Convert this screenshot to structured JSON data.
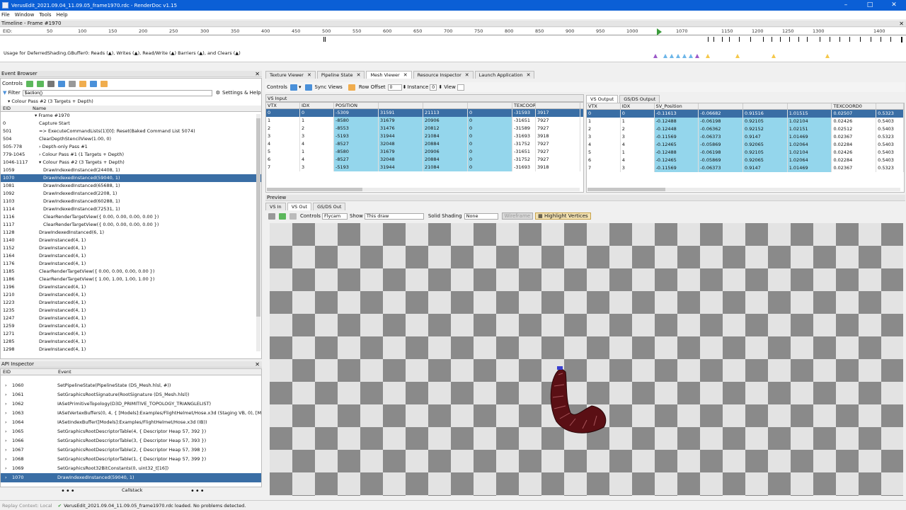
{
  "window": {
    "title": "VerusEdit_2021.09.04_11.09.05_frame1970.rdc - RenderDoc v1.15"
  },
  "menu": [
    "File",
    "Window",
    "Tools",
    "Help"
  ],
  "timeline": {
    "title": "Timeline - Frame #1970",
    "eid_label": "EID:",
    "ticks": [
      "50",
      "100",
      "150",
      "200",
      "250",
      "300",
      "350",
      "400",
      "450",
      "500",
      "550",
      "600",
      "650",
      "700",
      "750",
      "800",
      "850",
      "900",
      "950",
      "1000",
      "1070",
      "1150",
      "1200",
      "1250",
      "1300",
      "1400"
    ],
    "usage_text": "Usage for DeferredShading.GBuffer0: Reads (▲), Writes (▲), Read/Write (▲) Barriers (▲), and Clears (▲)"
  },
  "event_browser": {
    "title": "Event Browser",
    "controls_label": "Controls",
    "filter_label": "Filter",
    "filter_value": "$action()",
    "settings_label": "Settings & Help",
    "breadcrumb": "Colour Pass #2 (3 Targets + Depth)",
    "col_eid": "EID",
    "col_name": "Name",
    "rows": [
      {
        "eid": "",
        "name": "▾ Frame #1970",
        "indent": 1
      },
      {
        "eid": "0",
        "name": "Capture Start",
        "indent": 2
      },
      {
        "eid": "501",
        "name": "=> ExecuteCommandLists(1)[0]: Reset(Baked Command List 5074)",
        "indent": 2
      },
      {
        "eid": "504",
        "name": "ClearDepthStencilView(1.00, 0)",
        "indent": 2
      },
      {
        "eid": "505-778",
        "name": "› Depth-only Pass #1",
        "indent": 2
      },
      {
        "eid": "779-1045",
        "name": "› Colour Pass #1 (1 Targets + Depth)",
        "indent": 2
      },
      {
        "eid": "1046-1117",
        "name": "▾ Colour Pass #2 (3 Targets + Depth)",
        "indent": 2
      },
      {
        "eid": "1059",
        "name": "DrawIndexedInstanced(24408, 1)",
        "indent": 3
      },
      {
        "eid": "1070",
        "name": "DrawIndexedInstanced(59040, 1)",
        "indent": 3,
        "selected": true
      },
      {
        "eid": "1081",
        "name": "DrawIndexedInstanced(65688, 1)",
        "indent": 3
      },
      {
        "eid": "1092",
        "name": "DrawIndexedInstanced(2208, 1)",
        "indent": 3
      },
      {
        "eid": "1103",
        "name": "DrawIndexedInstanced(60288, 1)",
        "indent": 3
      },
      {
        "eid": "1114",
        "name": "DrawIndexedInstanced(72531, 1)",
        "indent": 3
      },
      {
        "eid": "1116",
        "name": "ClearRenderTargetView({ 0.00, 0.00, 0.00, 0.00 })",
        "indent": 3
      },
      {
        "eid": "1117",
        "name": "ClearRenderTargetView({ 0.00, 0.00, 0.00, 0.00 })",
        "indent": 3
      },
      {
        "eid": "1128",
        "name": "DrawIndexedInstanced(6, 1)",
        "indent": 2
      },
      {
        "eid": "1140",
        "name": "DrawInstanced(4, 1)",
        "indent": 2
      },
      {
        "eid": "1152",
        "name": "DrawInstanced(4, 1)",
        "indent": 2
      },
      {
        "eid": "1164",
        "name": "DrawInstanced(4, 1)",
        "indent": 2
      },
      {
        "eid": "1176",
        "name": "DrawInstanced(4, 1)",
        "indent": 2
      },
      {
        "eid": "1185",
        "name": "ClearRenderTargetView({ 0.00, 0.00, 0.00, 0.00 })",
        "indent": 2
      },
      {
        "eid": "1186",
        "name": "ClearRenderTargetView({ 1.00, 1.00, 1.00, 1.00 })",
        "indent": 2
      },
      {
        "eid": "1196",
        "name": "DrawInstanced(4, 1)",
        "indent": 2
      },
      {
        "eid": "1210",
        "name": "DrawInstanced(4, 1)",
        "indent": 2
      },
      {
        "eid": "1223",
        "name": "DrawInstanced(4, 1)",
        "indent": 2
      },
      {
        "eid": "1235",
        "name": "DrawInstanced(4, 1)",
        "indent": 2
      },
      {
        "eid": "1247",
        "name": "DrawInstanced(4, 1)",
        "indent": 2
      },
      {
        "eid": "1259",
        "name": "DrawInstanced(4, 1)",
        "indent": 2
      },
      {
        "eid": "1271",
        "name": "DrawInstanced(4, 1)",
        "indent": 2
      },
      {
        "eid": "1285",
        "name": "DrawInstanced(4, 1)",
        "indent": 2
      },
      {
        "eid": "1298",
        "name": "DrawInstanced(4, 1)",
        "indent": 2
      }
    ]
  },
  "api_inspector": {
    "title": "API Inspector",
    "col_eid": "EID",
    "col_event": "Event",
    "rows": [
      {
        "eid": "1060",
        "event": "SetPipelineState(PipelineState (DS_Mesh.hlsl, #))"
      },
      {
        "eid": "1061",
        "event": "SetGraphicsRootSignature(RootSignature (DS_Mesh.hlsl))"
      },
      {
        "eid": "1062",
        "event": "IASetPrimitiveTopology(D3D_PRIMITIVE_TOPOLOGY_TRIANGLELIST)"
      },
      {
        "eid": "1063",
        "event": "IASetVertexBuffers(0, 4, { [Models]:Examples/FlightHelmet/Hose.x3d (Staging VB, 0), [Mo"
      },
      {
        "eid": "1064",
        "event": "IASetIndexBuffer([Models]:Examples/FlightHelmet/Hose.x3d (IB))"
      },
      {
        "eid": "1065",
        "event": "SetGraphicsRootDescriptorTable(4, { Descriptor Heap 57, 392 })"
      },
      {
        "eid": "1066",
        "event": "SetGraphicsRootDescriptorTable(3, { Descriptor Heap 57, 393 })"
      },
      {
        "eid": "1067",
        "event": "SetGraphicsRootDescriptorTable(2, { Descriptor Heap 57, 398 })"
      },
      {
        "eid": "1068",
        "event": "SetGraphicsRootDescriptorTable(1, { Descriptor Heap 57, 399 })"
      },
      {
        "eid": "1069",
        "event": "SetGraphicsRoot32BitConstants(0, uint32_t[16])"
      },
      {
        "eid": "1070",
        "event": "DrawIndexedInstanced(59040, 1)",
        "selected": true
      }
    ],
    "callstack_label": "Callstack"
  },
  "tabs": [
    "Texture Viewer",
    "Pipeline State",
    "Mesh Viewer",
    "Resource Inspector",
    "Launch Application"
  ],
  "mesh_viewer": {
    "controls_label": "Controls",
    "sync_views_label": "Sync Views",
    "row_offset_label": "Row Offset",
    "row_offset_value": "0",
    "instance_label": "Instance",
    "instance_value": "0",
    "view_label": "View",
    "vs_input": {
      "title": "VS Input",
      "headers": [
        "VTX",
        "IDX",
        "POSITION",
        "",
        "",
        "",
        "TEXCOORD",
        ""
      ],
      "rows": [
        [
          "0",
          "0",
          "-5309",
          "31591",
          "21113",
          "0",
          "-31593",
          "3917"
        ],
        [
          "1",
          "1",
          "-8580",
          "31679",
          "20906",
          "0",
          "-31651",
          "7927"
        ],
        [
          "2",
          "2",
          "-8553",
          "31476",
          "20812",
          "0",
          "-31589",
          "7927"
        ],
        [
          "3",
          "3",
          "-5193",
          "31944",
          "21084",
          "0",
          "-31693",
          "3918"
        ],
        [
          "4",
          "4",
          "-8527",
          "32048",
          "20884",
          "0",
          "-31752",
          "7927"
        ],
        [
          "5",
          "1",
          "-8580",
          "31679",
          "20906",
          "0",
          "-31651",
          "7927"
        ],
        [
          "6",
          "4",
          "-8527",
          "32048",
          "20884",
          "0",
          "-31752",
          "7927"
        ],
        [
          "7",
          "3",
          "-5193",
          "31944",
          "21084",
          "0",
          "-31693",
          "3918"
        ]
      ]
    },
    "vs_output": {
      "tab1": "VS Output",
      "tab2": "GS/DS Output",
      "headers": [
        "VTX",
        "IDX",
        "SV_Position",
        "",
        "",
        "",
        "TEXCOORD0",
        ""
      ],
      "rows": [
        [
          "0",
          "0",
          "-0.11613",
          "-0.06682",
          "0.91516",
          "1.01515",
          "0.02507",
          "0.5323"
        ],
        [
          "1",
          "1",
          "-0.12488",
          "-0.06198",
          "0.92105",
          "1.02104",
          "0.02426",
          "0.5403"
        ],
        [
          "2",
          "2",
          "-0.12448",
          "-0.06362",
          "0.92152",
          "1.02151",
          "0.02512",
          "0.5403"
        ],
        [
          "3",
          "3",
          "-0.11569",
          "-0.06373",
          "0.9147",
          "1.01469",
          "0.02367",
          "0.5323"
        ],
        [
          "4",
          "4",
          "-0.12465",
          "-0.05869",
          "0.92065",
          "1.02064",
          "0.02284",
          "0.5403"
        ],
        [
          "5",
          "1",
          "-0.12488",
          "-0.06198",
          "0.92105",
          "1.02104",
          "0.02426",
          "0.5403"
        ],
        [
          "6",
          "4",
          "-0.12465",
          "-0.05869",
          "0.92065",
          "1.02064",
          "0.02284",
          "0.5403"
        ],
        [
          "7",
          "3",
          "-0.11569",
          "-0.06373",
          "0.9147",
          "1.01469",
          "0.02367",
          "0.5323"
        ]
      ]
    },
    "preview": {
      "title": "Preview",
      "tabs": [
        "VS In",
        "VS Out",
        "GS/DS Out"
      ],
      "controls_label": "Controls",
      "camera_value": "Flycam",
      "show_label": "Show",
      "show_value": "This draw",
      "solid_shading_label": "Solid Shading",
      "solid_shading_value": "None",
      "wireframe_label": "Wireframe",
      "highlight_label": "Highlight Vertices"
    }
  },
  "status": {
    "replay": "Replay Context: Local",
    "message": "VerusEdit_2021.09.04_11.09.05_frame1970.rdc loaded. No problems detected."
  }
}
